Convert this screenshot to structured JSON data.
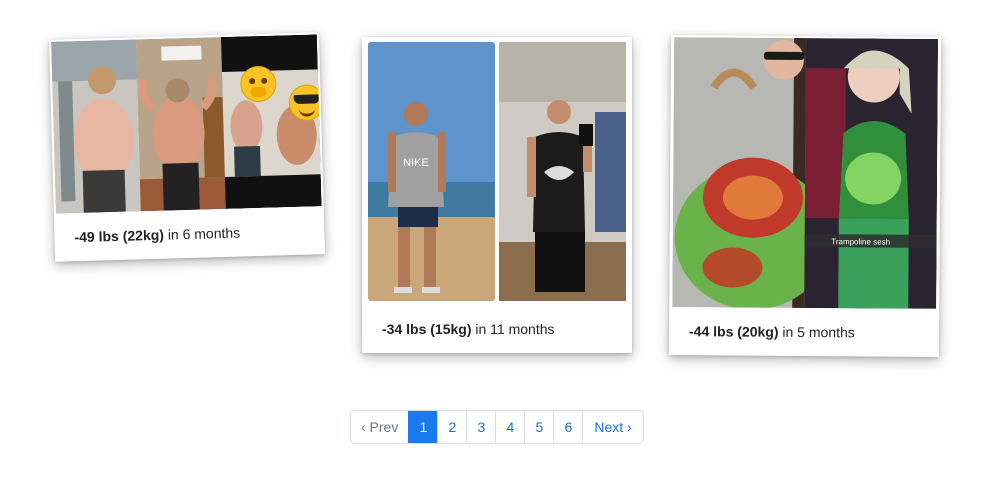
{
  "cards": [
    {
      "weight": "-49 lbs (22kg)",
      "duration": "in 6 months"
    },
    {
      "weight": "-34 lbs (15kg)",
      "duration": "in 11 months",
      "shirt_text": "NIKE"
    },
    {
      "weight": "-44 lbs (20kg)",
      "duration": "in 5 months",
      "overlay_text": "Trampoline sesh"
    }
  ],
  "pagination": {
    "prev": "‹ Prev",
    "pages": [
      "1",
      "2",
      "3",
      "4",
      "5",
      "6"
    ],
    "active": "1",
    "next": "Next ›"
  },
  "colors": {
    "accent": "#1a7af0",
    "link": "#1a6fd6"
  }
}
